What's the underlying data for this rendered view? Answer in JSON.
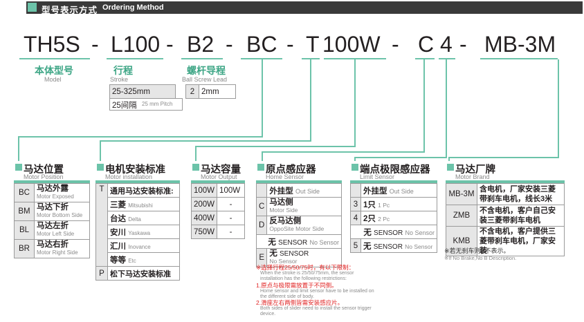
{
  "header": {
    "title_cn": "型号表示方式",
    "title_en": "Ordering Method"
  },
  "code": {
    "p1": "TH5S",
    "d1": "-",
    "p2": "L100",
    "d2": "-",
    "p3": "B2",
    "d3": "-",
    "p4": "BC",
    "d4": "-",
    "p5": "T",
    "p6": "100W",
    "d5": "-",
    "p7": "C",
    "p8": "4",
    "d6": "-",
    "p9": "MB-3M"
  },
  "model": {
    "cn": "本体型号",
    "en": "Model"
  },
  "stroke": {
    "cn": "行程",
    "en": "Stroke",
    "range": "25-325mm",
    "pitch_cn": "25间隔",
    "pitch_en": "25 mm Pitch"
  },
  "lead": {
    "cn": "螺杆导程",
    "en": "Ball Screw Lead",
    "code": "2",
    "value": "2mm"
  },
  "motor_position": {
    "cn": "马达位置",
    "en": "Motor Position",
    "rows": [
      {
        "code": "BC",
        "cn": "马达外露",
        "en": "Motor Exposed"
      },
      {
        "code": "BM",
        "cn": "马达下折",
        "en": "Motor Bottom Side"
      },
      {
        "code": "BL",
        "cn": "马达左折",
        "en": "Motor Left Side"
      },
      {
        "code": "BR",
        "cn": "马达右折",
        "en": "Motor Right Side"
      }
    ]
  },
  "motor_install": {
    "cn": "电机安装标准",
    "en": "Motor installation",
    "t_code": "T",
    "t_label": "通用马达安装标准:",
    "brands": [
      {
        "cn": "三菱",
        "en": "Mitsubishi"
      },
      {
        "cn": "台达",
        "en": "Delta"
      },
      {
        "cn": "安川",
        "en": "Yaskawa"
      },
      {
        "cn": "汇川",
        "en": "Inovance"
      },
      {
        "cn": "等等",
        "en": "Etc"
      }
    ],
    "p_code": "P",
    "p_label": "松下马达安装标准"
  },
  "motor_output": {
    "cn": "马达容量",
    "en": "Motor Output",
    "rows": [
      {
        "code": "100W",
        "value": "100W"
      },
      {
        "code": "200W",
        "value": "-"
      },
      {
        "code": "400W",
        "value": "-"
      },
      {
        "code": "750W",
        "value": "-"
      }
    ]
  },
  "home_sensor": {
    "cn": "原点感应器",
    "en": "Home Sensor",
    "head_cn": "外挂型",
    "head_en": "Out Side",
    "rows": [
      {
        "code": "C",
        "cn": "马达侧",
        "en": "Motor Side"
      },
      {
        "code": "D",
        "cn": "反马达侧",
        "en": "OppoSite Motor Side"
      }
    ],
    "none_cn": "无",
    "none_label": "SENSOR",
    "none_en": "No Sensor",
    "e_code": "E",
    "e_cn": "无",
    "e_label": "SENSOR",
    "e_en": "No Sensor"
  },
  "limit_sensor": {
    "cn": "端点极限感应器",
    "en": "Limit Sensor",
    "head_cn": "外挂型",
    "head_en": "Out Side",
    "rows": [
      {
        "code": "3",
        "cn": "1只",
        "en": "1 Pc"
      },
      {
        "code": "4",
        "cn": "2只",
        "en": "2 Pc"
      }
    ],
    "none_cn": "无",
    "none_label": "SENSOR",
    "none_en": "No Sensor",
    "code5": "5",
    "none2_cn": "无",
    "none2_label": "SENSOR",
    "none2_en": "No Sensor"
  },
  "motor_brand": {
    "cn": "马达厂牌",
    "en": "Motor Brand",
    "rows": [
      {
        "code": "MB-3M",
        "desc": "含电机，厂家安装三菱带刹车电机，线长3米"
      },
      {
        "code": "ZMB",
        "desc": "不含电机，客户自己安装三菱带刹车电机"
      },
      {
        "code": "KMB",
        "desc": "不含电机，客户提供三菱带刹车电机，厂家安装"
      }
    ],
    "note_cn": "※若无刹车则B不表示。",
    "note_en": "※If No Brake,No B Description."
  },
  "notes": {
    "title_cn": "※选择行程25/50/75时，有以下限制：",
    "title_en": "When the stroke is 25/50/75mm, the sensor installation has the following restrictions:",
    "n1_cn": "1.原点与极限需放置于不同侧。",
    "n1_en": "Home sensor and limit sensor have to be installed on the different side of body.",
    "n2_cn": "2.滑座左右两侧皆需安装感应片。",
    "n2_en": "Both sides of slider need to install the sensor trigger device."
  },
  "colors": {
    "accent": "#6cc3a9",
    "label": "#3ea686",
    "header": "#3a3a3a",
    "note": "#e02020"
  }
}
